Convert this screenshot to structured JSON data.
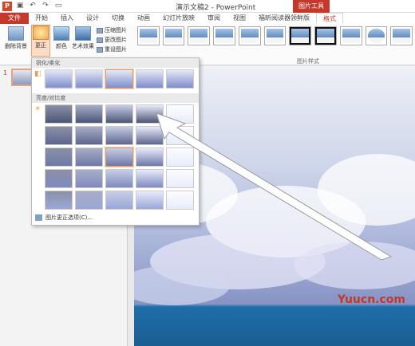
{
  "window": {
    "title": "演示文稿2 - PowerPoint",
    "contextual_tab_group": "图片工具",
    "app_icon": "P"
  },
  "quick_access": [
    "save-icon",
    "undo-icon",
    "redo-icon",
    "slideshow-icon"
  ],
  "tabs": [
    {
      "label": "文件"
    },
    {
      "label": "开始"
    },
    {
      "label": "插入"
    },
    {
      "label": "设计"
    },
    {
      "label": "切换"
    },
    {
      "label": "动画"
    },
    {
      "label": "幻灯片放映"
    },
    {
      "label": "审阅"
    },
    {
      "label": "视图"
    },
    {
      "label": "福昕阅读器领鲜版"
    },
    {
      "label": "格式"
    }
  ],
  "ribbon": {
    "remove_bg": "删除背景",
    "corrections": "更正",
    "color": "颜色",
    "artistic": "艺术效果",
    "compress": "压缩图片",
    "change": "更改图片",
    "reset": "重设图片",
    "styles_group": "图片样式"
  },
  "slide_pane": {
    "number": "1"
  },
  "dropdown": {
    "section_sharpen": "锐化/柔化",
    "section_brightness": "亮度/对比度",
    "footer": "图片更正选项(C)..."
  },
  "watermark": "Yuucn.com",
  "colors": {
    "accent": "#c5392c",
    "highlight": "#fcdcc4"
  }
}
